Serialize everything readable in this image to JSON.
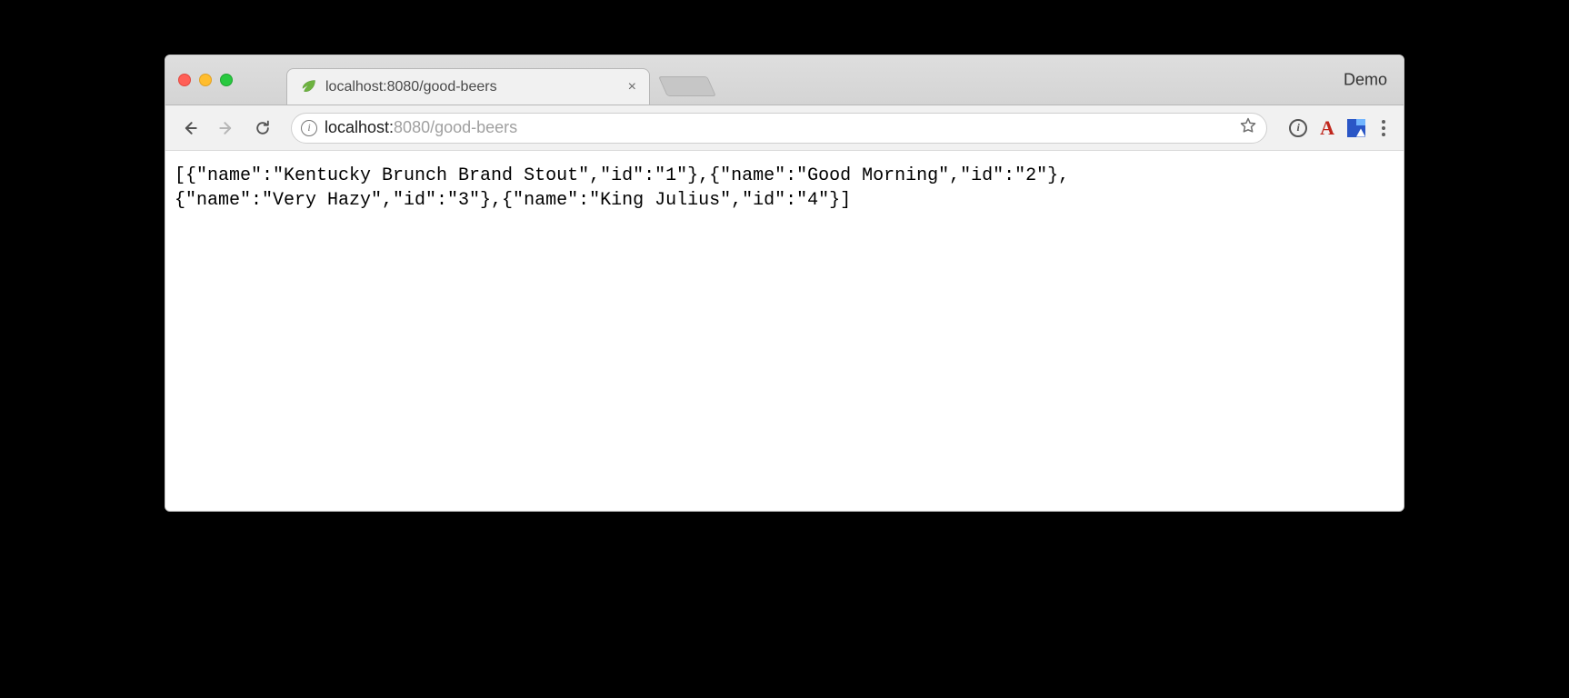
{
  "window": {
    "traffic_lights": {
      "red": "#ff5f57",
      "yellow": "#ffbd2e",
      "green": "#28c940"
    },
    "demo_label": "Demo"
  },
  "tab": {
    "title": "localhost:8080/good-beers",
    "favicon_name": "spring-leaf-icon",
    "close_glyph": "×"
  },
  "toolbar": {
    "url_host": "localhost:",
    "url_port_path": "8080/good-beers",
    "security_info_glyph": "i",
    "extension_info_glyph": "i",
    "extension_letter": "A"
  },
  "page": {
    "raw_json": "[{\"name\":\"Kentucky Brunch Brand Stout\",\"id\":\"1\"},{\"name\":\"Good Morning\",\"id\":\"2\"},\n{\"name\":\"Very Hazy\",\"id\":\"3\"},{\"name\":\"King Julius\",\"id\":\"4\"}]",
    "data": [
      {
        "name": "Kentucky Brunch Brand Stout",
        "id": "1"
      },
      {
        "name": "Good Morning",
        "id": "2"
      },
      {
        "name": "Very Hazy",
        "id": "3"
      },
      {
        "name": "King Julius",
        "id": "4"
      }
    ]
  }
}
